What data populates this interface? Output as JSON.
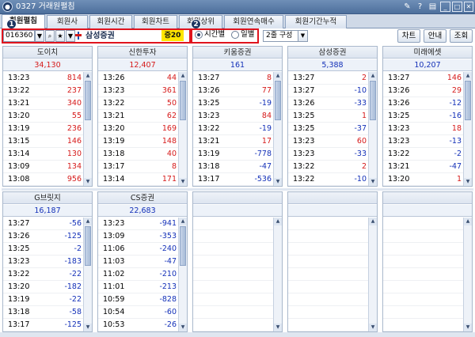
{
  "window": {
    "title": "0327 거래원펼침",
    "icon": "app-logo-icon"
  },
  "tabs": [
    {
      "label": "회원펼침",
      "active": true
    },
    {
      "label": "회원사"
    },
    {
      "label": "회원시간"
    },
    {
      "label": "회원차트"
    },
    {
      "label": "회원상위"
    },
    {
      "label": "회원연속매수"
    },
    {
      "label": "회원기간누적"
    }
  ],
  "badges": [
    "1",
    "2"
  ],
  "search": {
    "code": "016360",
    "name": "삼성증권",
    "cert_badge": "증20"
  },
  "view_mode": {
    "options": [
      "시간별",
      "일별"
    ],
    "selected": "시간별"
  },
  "layout_select": "2줄 구성",
  "buttons": [
    "차트",
    "안내",
    "조회"
  ],
  "colors": {
    "up": "#d61a1a",
    "down": "#1330b8",
    "highlight": "#ffe600",
    "focus_border": "#e0141e"
  },
  "panels": [
    {
      "broker": "도이치",
      "total": "34,130",
      "rows": [
        {
          "time": "13:23",
          "qty": "814",
          "dir": "up"
        },
        {
          "time": "13:22",
          "qty": "237",
          "dir": "up"
        },
        {
          "time": "13:21",
          "qty": "340",
          "dir": "up"
        },
        {
          "time": "13:20",
          "qty": "55",
          "dir": "up"
        },
        {
          "time": "13:19",
          "qty": "236",
          "dir": "up"
        },
        {
          "time": "13:15",
          "qty": "146",
          "dir": "up"
        },
        {
          "time": "13:14",
          "qty": "130",
          "dir": "up"
        },
        {
          "time": "13:09",
          "qty": "134",
          "dir": "up"
        },
        {
          "time": "13:08",
          "qty": "956",
          "dir": "up"
        }
      ]
    },
    {
      "broker": "신한투자",
      "total": "12,407",
      "rows": [
        {
          "time": "13:26",
          "qty": "44",
          "dir": "up"
        },
        {
          "time": "13:23",
          "qty": "361",
          "dir": "up"
        },
        {
          "time": "13:22",
          "qty": "50",
          "dir": "up"
        },
        {
          "time": "13:21",
          "qty": "62",
          "dir": "up"
        },
        {
          "time": "13:20",
          "qty": "169",
          "dir": "up"
        },
        {
          "time": "13:19",
          "qty": "148",
          "dir": "up"
        },
        {
          "time": "13:18",
          "qty": "40",
          "dir": "up"
        },
        {
          "time": "13:17",
          "qty": "8",
          "dir": "up"
        },
        {
          "time": "13:14",
          "qty": "171",
          "dir": "up"
        }
      ]
    },
    {
      "broker": "키움증권",
      "total": "161",
      "rows": [
        {
          "time": "13:27",
          "qty": "8",
          "dir": "up"
        },
        {
          "time": "13:26",
          "qty": "77",
          "dir": "up"
        },
        {
          "time": "13:25",
          "qty": "-19",
          "dir": "down"
        },
        {
          "time": "13:23",
          "qty": "84",
          "dir": "up"
        },
        {
          "time": "13:22",
          "qty": "-19",
          "dir": "down"
        },
        {
          "time": "13:21",
          "qty": "17",
          "dir": "up"
        },
        {
          "time": "13:19",
          "qty": "-778",
          "dir": "down"
        },
        {
          "time": "13:18",
          "qty": "-47",
          "dir": "down"
        },
        {
          "time": "13:17",
          "qty": "-536",
          "dir": "down"
        }
      ]
    },
    {
      "broker": "삼성증권",
      "total": "5,388",
      "rows": [
        {
          "time": "13:27",
          "qty": "2",
          "dir": "up"
        },
        {
          "time": "13:27",
          "qty": "-10",
          "dir": "down"
        },
        {
          "time": "13:26",
          "qty": "-33",
          "dir": "down"
        },
        {
          "time": "13:25",
          "qty": "1",
          "dir": "up"
        },
        {
          "time": "13:25",
          "qty": "-37",
          "dir": "down"
        },
        {
          "time": "13:23",
          "qty": "60",
          "dir": "up"
        },
        {
          "time": "13:23",
          "qty": "-33",
          "dir": "down"
        },
        {
          "time": "13:22",
          "qty": "2",
          "dir": "up"
        },
        {
          "time": "13:22",
          "qty": "-10",
          "dir": "down"
        }
      ]
    },
    {
      "broker": "미래에셋",
      "total": "10,207",
      "rows": [
        {
          "time": "13:27",
          "qty": "146",
          "dir": "up"
        },
        {
          "time": "13:26",
          "qty": "29",
          "dir": "up"
        },
        {
          "time": "13:26",
          "qty": "-12",
          "dir": "down"
        },
        {
          "time": "13:25",
          "qty": "-16",
          "dir": "down"
        },
        {
          "time": "13:23",
          "qty": "18",
          "dir": "up"
        },
        {
          "time": "13:23",
          "qty": "-13",
          "dir": "down"
        },
        {
          "time": "13:22",
          "qty": "-2",
          "dir": "down"
        },
        {
          "time": "13:21",
          "qty": "-47",
          "dir": "down"
        },
        {
          "time": "13:20",
          "qty": "1",
          "dir": "up"
        }
      ]
    },
    {
      "broker": "G브릿지",
      "total": "16,187",
      "rows": [
        {
          "time": "13:27",
          "qty": "-56",
          "dir": "down"
        },
        {
          "time": "13:26",
          "qty": "-125",
          "dir": "down"
        },
        {
          "time": "13:25",
          "qty": "-2",
          "dir": "down"
        },
        {
          "time": "13:23",
          "qty": "-183",
          "dir": "down"
        },
        {
          "time": "13:22",
          "qty": "-22",
          "dir": "down"
        },
        {
          "time": "13:20",
          "qty": "-182",
          "dir": "down"
        },
        {
          "time": "13:19",
          "qty": "-22",
          "dir": "down"
        },
        {
          "time": "13:18",
          "qty": "-58",
          "dir": "down"
        },
        {
          "time": "13:17",
          "qty": "-125",
          "dir": "down"
        }
      ]
    },
    {
      "broker": "CS증권",
      "total": "22,683",
      "rows": [
        {
          "time": "13:23",
          "qty": "-941",
          "dir": "down"
        },
        {
          "time": "13:09",
          "qty": "-353",
          "dir": "down"
        },
        {
          "time": "11:06",
          "qty": "-240",
          "dir": "down"
        },
        {
          "time": "11:03",
          "qty": "-47",
          "dir": "down"
        },
        {
          "time": "11:02",
          "qty": "-210",
          "dir": "down"
        },
        {
          "time": "11:01",
          "qty": "-213",
          "dir": "down"
        },
        {
          "time": "10:59",
          "qty": "-828",
          "dir": "down"
        },
        {
          "time": "10:54",
          "qty": "-60",
          "dir": "down"
        },
        {
          "time": "10:53",
          "qty": "-26",
          "dir": "down"
        }
      ]
    },
    {
      "broker": "",
      "total": "",
      "rows": []
    },
    {
      "broker": "",
      "total": "",
      "rows": []
    },
    {
      "broker": "",
      "total": "",
      "rows": []
    }
  ]
}
